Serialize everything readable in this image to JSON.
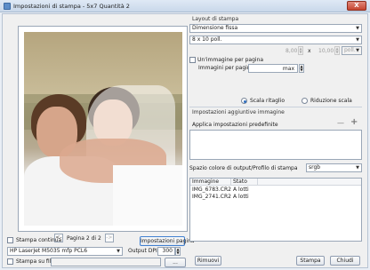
{
  "window": {
    "title": "Impostazioni di stampa - 5x7 Quantità 2",
    "close_glyph": "X"
  },
  "preview": {
    "page_label": "Pagina 2 di 2",
    "prev_glyph": "<-",
    "next_glyph": "->"
  },
  "bottom_left": {
    "continuous_print_label": "Stampa continua",
    "page_setup_button": "Impostazioni pagina",
    "printer_select": "HP LaserJet M5035 mfp PCL6",
    "output_dpi_label": "Output DPI",
    "output_dpi_value": "300",
    "print_to_file_label": "Stampa su file",
    "browse_button": "..."
  },
  "layout": {
    "section_title": "Layout di stampa",
    "size_mode_select": "Dimensione fissa",
    "paper_size_select": "8 x 10 poll.",
    "width_value": "8,00",
    "times_glyph": "x",
    "height_value": "10,00",
    "unit_select": "poll.",
    "one_image_per_page_label": "Un'immagine per pagina",
    "images_per_page_label": "Immagini per pagina",
    "max_label": "max",
    "scale_crop_label": "Scala ritaglio",
    "scale_reduce_label": "Riduzione scala"
  },
  "additional": {
    "section_title": "Impostazioni aggiuntive immagine",
    "apply_presets_label": "Applica impostazioni predefinite",
    "minus_glyph": "—",
    "plus_glyph": "+",
    "color_space_label": "Spazio colore di output/Profilo di stampa",
    "color_space_select": "srgb"
  },
  "images_table": {
    "columns": [
      "Immagine",
      "Stato"
    ],
    "rows": [
      {
        "name": "IMG_6783.CR2",
        "status": "A lotti"
      },
      {
        "name": "IMG_2741.CR2",
        "status": "A lotti"
      }
    ]
  },
  "actions": {
    "remove_button": "Rimuovi",
    "print_button": "Stampa",
    "close_button": "Chiudi"
  },
  "colors": {
    "accent": "#3f7fd0",
    "titlebar": "#c9d8ea",
    "close": "#c6442f"
  }
}
